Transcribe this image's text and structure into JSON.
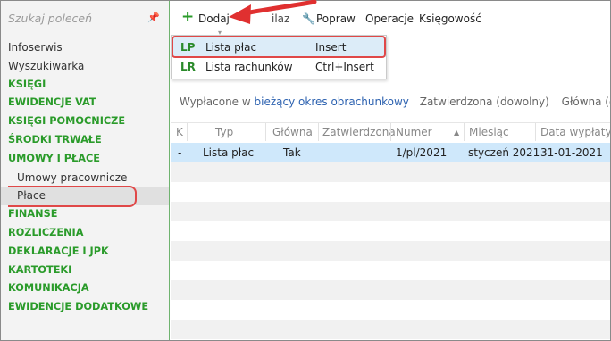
{
  "search": {
    "placeholder": "Szukaj poleceń"
  },
  "sidebar": {
    "items": [
      {
        "label": "Infoserwis",
        "kind": "plain"
      },
      {
        "label": "Wyszukiwarka",
        "kind": "plain"
      },
      {
        "label": "KSIĘGI",
        "kind": "section"
      },
      {
        "label": "EWIDENCJE VAT",
        "kind": "section"
      },
      {
        "label": "KSIĘGI POMOCNICZE",
        "kind": "section"
      },
      {
        "label": "ŚRODKI TRWAŁE",
        "kind": "section"
      },
      {
        "label": "UMOWY I PŁACE",
        "kind": "section"
      },
      {
        "label": "Umowy pracownicze",
        "kind": "sub"
      },
      {
        "label": "Płace",
        "kind": "sub-selected"
      },
      {
        "label": "FINANSE",
        "kind": "section"
      },
      {
        "label": "ROZLICZENIA",
        "kind": "section"
      },
      {
        "label": "DEKLARACJE I JPK",
        "kind": "section"
      },
      {
        "label": "KARTOTEKI",
        "kind": "section"
      },
      {
        "label": "KOMUNIKACJA",
        "kind": "section"
      },
      {
        "label": "EWIDENCJE DODATKOWE",
        "kind": "section"
      }
    ]
  },
  "toolbar": {
    "add_label": "Dodaj",
    "partial_label": "ilaz",
    "edit_label": "Popraw",
    "operations_label": "Operacje",
    "accounting_label": "Księgowość"
  },
  "dropdown": {
    "items": [
      {
        "code": "LP",
        "label": "Lista płac",
        "shortcut": "Insert"
      },
      {
        "code": "LR",
        "label": "Lista rachunków",
        "shortcut": "Ctrl+Insert"
      }
    ]
  },
  "filters": {
    "paid_prefix": "Wypłacone w",
    "paid_link": "bieżący okres obrachunkowy",
    "approved": "Zatwierdzona (dowolny)",
    "main": "Główna (dowolny)"
  },
  "grid": {
    "columns": [
      "K",
      "Typ",
      "Główna",
      "Zatwierdzona",
      "Numer",
      "Miesiąc",
      "Data wypłaty"
    ],
    "rows": [
      {
        "k": "-",
        "typ": "Lista płac",
        "glowna": "Tak",
        "zatwierdzona": "",
        "numer": "1/pl/2021",
        "miesiac": "styczeń 2021",
        "data": "31-01-2021"
      }
    ]
  },
  "colors": {
    "accent": "#2a9b2a",
    "link": "#2d62b0",
    "highlight": "#e04848",
    "selection": "#cfe8fb"
  }
}
